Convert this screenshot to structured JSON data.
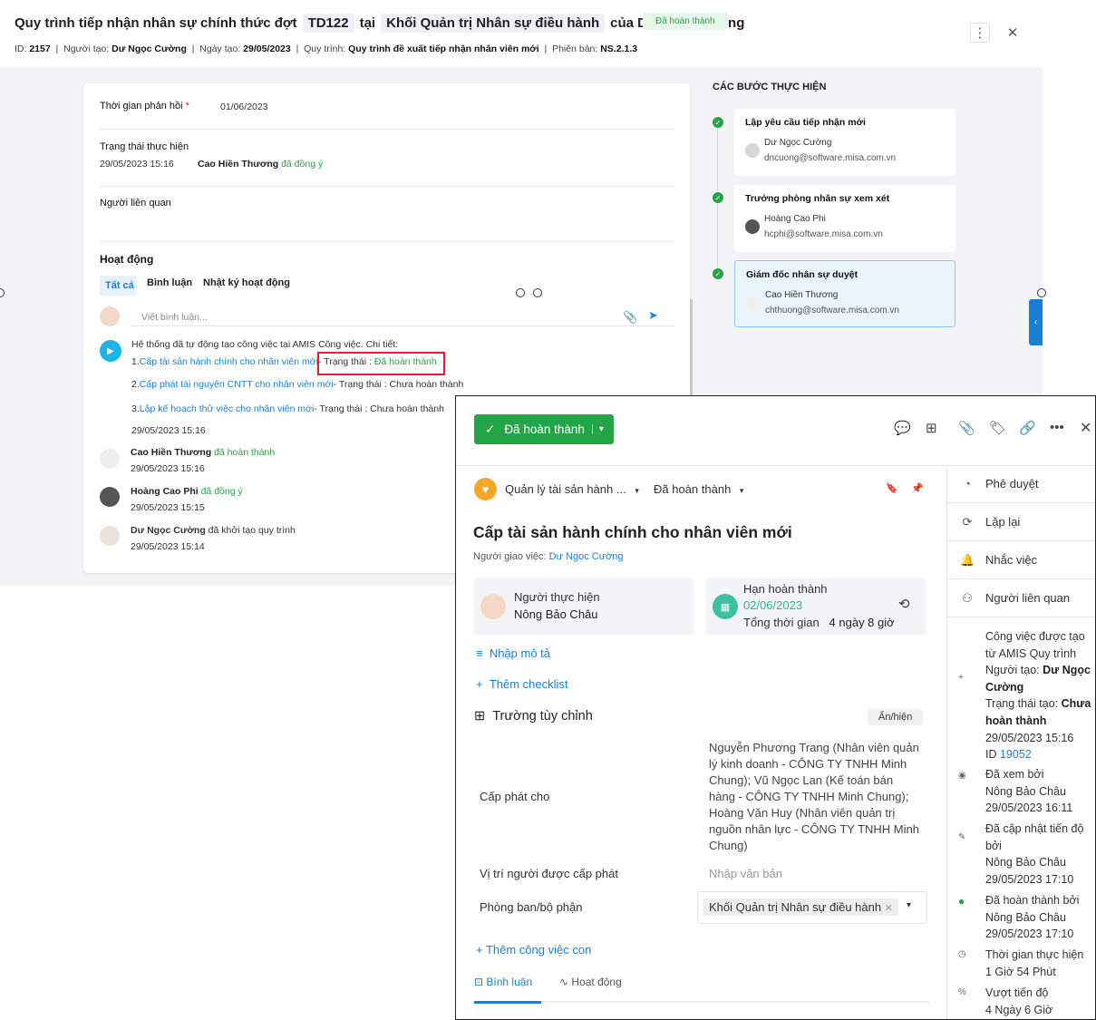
{
  "header": {
    "title_prefix": "Quy trình tiếp nhận nhân sự chính thức đợt",
    "code": "TD122",
    "at": "tại",
    "dept": "Khối Quản trị Nhân sự điều hành",
    "of": "của Dư Ngọc Cường",
    "status": "Đã hoàn thành",
    "meta_id_label": "ID:",
    "meta_id": "2157",
    "meta_creator_label": "Người tạo:",
    "meta_creator": "Dư Ngọc Cường",
    "meta_date_label": "Ngày tạo:",
    "meta_date": "29/05/2023",
    "meta_process_label": "Quy trình:",
    "meta_process": "Quy trình đề xuất tiếp nhận nhân viên mới",
    "meta_version_label": "Phiên bản:",
    "meta_version": "NS.2.1.3"
  },
  "form": {
    "response_label": "Thời gian phản hồi",
    "required_mark": "*",
    "response_value": "01/06/2023",
    "status_label": "Trạng thái thực hiện",
    "status_time": "29/05/2023 15:16",
    "status_person": "Cao Hiền Thương",
    "status_action": "đã đồng ý",
    "related_label": "Người liên quan",
    "activity_label": "Hoạt động",
    "tabs": [
      "Tất cả",
      "Bình luận",
      "Nhật ký hoạt động"
    ],
    "comment_placeholder": "Viết bình luận..."
  },
  "auto": {
    "intro": "Hệ thống đã tự động tạo công việc tại AMIS Công việc. Chi tiết:",
    "items": [
      {
        "num": "1.",
        "name": "Cấp tài sản hành chính cho nhân viên mới",
        "sep": "- Trạng thái :",
        "state": "Đã hoàn thành"
      },
      {
        "num": "2.",
        "name": "Cấp phát tài nguyên CNTT cho nhân viên mới",
        "sep": "- Trạng thái :",
        "state": "Chưa hoàn thành"
      },
      {
        "num": "3.",
        "name": "Lập kế hoạch thử việc cho nhân viên mới",
        "sep": "- Trạng thái :",
        "state": "Chưa hoàn thành"
      }
    ],
    "time": "29/05/2023 15:16"
  },
  "log": [
    {
      "name": "Cao Hiền Thương",
      "action": "đã hoàn thành",
      "time": "29/05/2023 15:16"
    },
    {
      "name": "Hoàng Cao Phi",
      "action": "đã đồng ý",
      "time": "29/05/2023 15:15"
    },
    {
      "name": "Dư Ngọc Cường",
      "action": "đã khởi tạo quy trình",
      "time": "29/05/2023 15:14"
    }
  ],
  "steps": {
    "title": "CÁC BƯỚC THỰC HIỆN",
    "items": [
      {
        "title": "Lập yêu cầu tiếp nhận mới",
        "name": "Dư Ngọc Cường",
        "email": "dncuong@software.misa.com.vn"
      },
      {
        "title": "Trưởng phòng nhân sự xem xét",
        "name": "Hoàng Cao Phi",
        "email": "hcphi@software.misa.com.vn"
      },
      {
        "title": "Giám đốc nhân sự duyệt",
        "name": "Cao Hiền Thương",
        "email": "chthuong@software.misa.com.vn"
      }
    ]
  },
  "popup": {
    "done_button": "Đã hoàn thành",
    "project": "Quản lý tài sản hành ...",
    "project_status": "Đã hoàn thành",
    "task_title": "Cấp tài sản hành chính cho nhân viên mới",
    "assigner_label": "Người giao việc:",
    "assigner": "Dư Ngọc Cường",
    "performer_label": "Người thực hiện",
    "performer": "Nông Bảo Châu",
    "deadline_label": "Hạn hoàn thành",
    "deadline": "02/06/2023",
    "total_label": "Tổng thời gian",
    "total": "4 ngày 8 giờ",
    "add_desc": "Nhập mô tả",
    "add_checklist": "Thêm checklist",
    "custom_fields": "Trường tùy chỉnh",
    "show_hide": "Ẩn/hiện",
    "alloc_label": "Cấp phát cho",
    "alloc_value": "Nguyễn Phương Trang (Nhân viên quản lý kinh doanh - CÔNG TY TNHH Minh Chung); Vũ Ngọc Lan (Kế toán bán hàng - CÔNG TY TNHH Minh Chung); Hoàng Văn Huy (Nhân viên quản trị nguồn nhân lực - CÔNG TY TNHH Minh Chung)",
    "position_label": "Vị trí người được cấp phát",
    "position_placeholder": "Nhập văn bản",
    "dept_label": "Phòng ban/bộ phận",
    "dept_value": "Khối Quản trị Nhân sự điều hành",
    "add_subtask": "Thêm công việc con",
    "tab_comment": "Bình luận",
    "tab_activity": "Hoạt động",
    "side": [
      "Phê duyệt",
      "Lặp lại",
      "Nhắc việc",
      "Người liên quan"
    ],
    "history": {
      "created_line1": "Công việc được tạo từ AMIS Quy trình",
      "creator_label": "Người tạo:",
      "creator": "Dư Ngọc Cường",
      "status_label": "Trạng thái tạo:",
      "status": "Chưa hoàn thành",
      "created_time": "29/05/2023  15:16",
      "id_label": "ID",
      "id": "19052",
      "viewed": "Đã xem bởi",
      "viewed_by": "Nông Bảo Châu",
      "viewed_time": "29/05/2023  16:11",
      "progress": "Đã cập nhật tiến độ bởi",
      "progress_by": "Nông Bảo Châu",
      "progress_time": "29/05/2023  17:10",
      "done": "Đã hoàn thành bởi",
      "done_by": "Nông Bảo Châu",
      "done_time": "29/05/2023  17:10",
      "exec_label": "Thời gian thực hiện",
      "exec": "1 Giờ 54 Phút",
      "over_label": "Vượt tiến độ",
      "over": "4 Ngày 6 Giờ"
    }
  }
}
